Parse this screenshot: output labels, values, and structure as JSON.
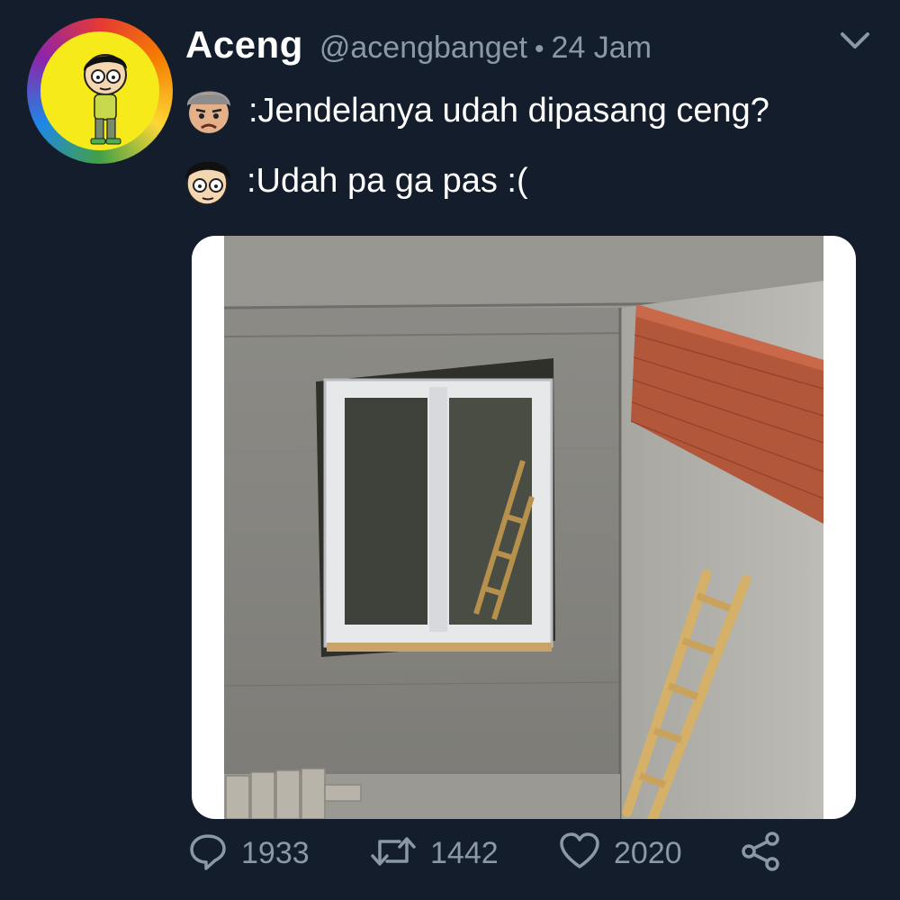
{
  "author": {
    "display_name": "Aceng",
    "handle": "@acengbanget",
    "separator": "•",
    "time": "24 Jam"
  },
  "dialogue": [
    {
      "speaker_icon": "father-face-icon",
      "text": ":Jendelanya udah dipasang ceng?"
    },
    {
      "speaker_icon": "aceng-face-icon",
      "text": ":Udah pa ga pas :("
    }
  ],
  "media": {
    "description_icon": "photo-misfit-window"
  },
  "stats": {
    "replies": "1933",
    "retweets": "1442",
    "likes": "2020"
  },
  "colors": {
    "background": "#141d2b",
    "muted_text": "#8a98a8",
    "text": "#ffffff",
    "avatar_bg": "#f6ea1a"
  },
  "icons": {
    "menu": "chevron-down-icon",
    "reply": "reply-icon",
    "retweet": "retweet-icon",
    "like": "heart-icon",
    "share": "share-icon"
  }
}
